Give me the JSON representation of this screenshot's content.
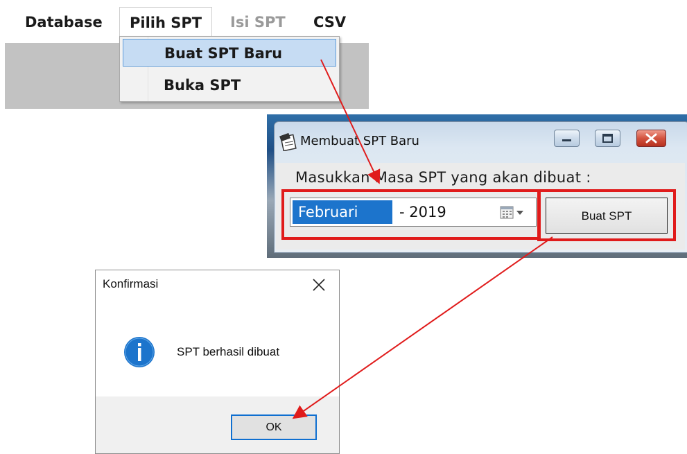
{
  "menubar": {
    "items": [
      {
        "label": "Database",
        "state": "normal"
      },
      {
        "label": "Pilih SPT",
        "state": "open"
      },
      {
        "label": "Isi SPT",
        "state": "disabled"
      },
      {
        "label": "CSV",
        "state": "normal"
      }
    ],
    "dropdown": [
      {
        "label": "Buat SPT Baru",
        "state": "hover"
      },
      {
        "label": "Buka SPT",
        "state": "normal"
      }
    ]
  },
  "spt_window": {
    "title": "Membuat SPT Baru",
    "prompt": "Masukkan Masa SPT yang akan dibuat :",
    "month": "Februari",
    "year": "- 2019",
    "button_label": "Buat SPT"
  },
  "dialog": {
    "title": "Konfirmasi",
    "message": "SPT berhasil dibuat",
    "ok_label": "OK"
  },
  "colors": {
    "annotation_red": "#e01b1b",
    "selection_blue": "#1c74cc",
    "menu_hover_bg": "#c6dcf3",
    "info_icon_blue": "#1c74cc"
  },
  "icons": [
    "app-logo-icon",
    "minimize-icon",
    "maximize-icon",
    "close-icon",
    "calendar-icon",
    "dropdown-arrow-icon",
    "info-icon"
  ]
}
